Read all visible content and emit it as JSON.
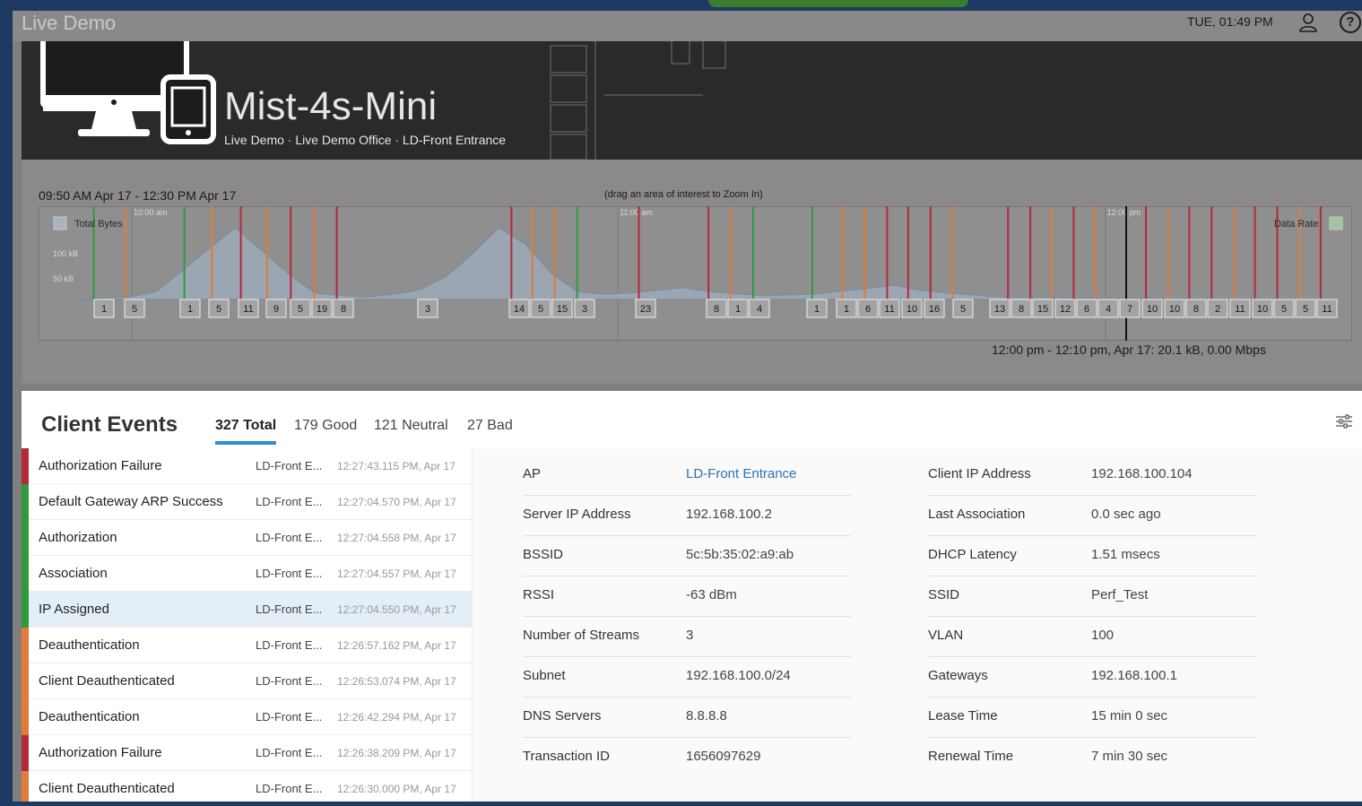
{
  "app": {
    "title": "Live Demo",
    "datetime": "TUE, 01:49 PM"
  },
  "device": {
    "name": "Mist-4s-Mini",
    "breadcrumb": "Live Demo · Live Demo Office · LD-Front Entrance"
  },
  "timeline": {
    "range_label": "09:50 AM Apr 17 - 12:30 PM Apr 17",
    "zoom_hint": "(drag an area of interest to Zoom In)",
    "legend_left": "Total Bytes",
    "legend_right": "Data Rate",
    "tooltip": "12:00 pm - 12:10 pm, Apr 17: 20.1 kB, 0.00 Mbps",
    "time_ticks": [
      {
        "label": "10:00 am",
        "x_pct": 7.1
      },
      {
        "label": "11:00 am",
        "x_pct": 44.1
      },
      {
        "label": "12:00 pm",
        "x_pct": 81.2
      }
    ],
    "y_ticks": [
      "100 kB",
      "50 kB"
    ],
    "event_counts": [
      "1",
      "5",
      "1",
      "5",
      "11",
      "9",
      "5",
      "19",
      "8",
      "3",
      "14",
      "5",
      "15",
      "3",
      "23",
      "8",
      "1",
      "4",
      "1",
      "1",
      "6",
      "11",
      "10",
      "16",
      "5",
      "13",
      "8",
      "15",
      "12",
      "6",
      "4",
      "7",
      "10",
      "10",
      "8",
      "2",
      "11",
      "10",
      "5",
      "5",
      "11"
    ],
    "event_lines": [
      {
        "t": 4.2,
        "c": "#2e9a3e"
      },
      {
        "t": 6.6,
        "c": "#e07b39"
      },
      {
        "t": 11.1,
        "c": "#2e9a3e"
      },
      {
        "t": 13.2,
        "c": "#e07b39"
      },
      {
        "t": 15.4,
        "c": "#b5283a"
      },
      {
        "t": 17.4,
        "c": "#e07b39"
      },
      {
        "t": 19.2,
        "c": "#b5283a"
      },
      {
        "t": 21.0,
        "c": "#e07b39"
      },
      {
        "t": 22.7,
        "c": "#b5283a"
      },
      {
        "t": 36.0,
        "c": "#b5283a"
      },
      {
        "t": 37.6,
        "c": "#e07b39"
      },
      {
        "t": 39.3,
        "c": "#e07b39"
      },
      {
        "t": 41.0,
        "c": "#2e9a3e"
      },
      {
        "t": 45.7,
        "c": "#b5283a"
      },
      {
        "t": 51.0,
        "c": "#b5283a"
      },
      {
        "t": 52.7,
        "c": "#e07b39"
      },
      {
        "t": 54.4,
        "c": "#2e9a3e"
      },
      {
        "t": 58.9,
        "c": "#2e9a3e"
      },
      {
        "t": 61.2,
        "c": "#e07b39"
      },
      {
        "t": 62.9,
        "c": "#e07b39"
      },
      {
        "t": 64.6,
        "c": "#b5283a"
      },
      {
        "t": 66.2,
        "c": "#b5283a"
      },
      {
        "t": 67.9,
        "c": "#b5283a"
      },
      {
        "t": 69.6,
        "c": "#e07b39"
      },
      {
        "t": 73.8,
        "c": "#b5283a"
      },
      {
        "t": 75.5,
        "c": "#b5283a"
      },
      {
        "t": 77.1,
        "c": "#e07b39"
      },
      {
        "t": 78.8,
        "c": "#b5283a"
      },
      {
        "t": 80.4,
        "c": "#e07b39"
      },
      {
        "t": 84.3,
        "c": "#b5283a"
      },
      {
        "t": 86.0,
        "c": "#e07b39"
      },
      {
        "t": 87.6,
        "c": "#b5283a"
      },
      {
        "t": 89.3,
        "c": "#b5283a"
      },
      {
        "t": 91.0,
        "c": "#e07b39"
      },
      {
        "t": 92.6,
        "c": "#b5283a"
      },
      {
        "t": 94.3,
        "c": "#b5283a"
      },
      {
        "t": 96.0,
        "c": "#e07b39"
      },
      {
        "t": 97.6,
        "c": "#b5283a"
      }
    ],
    "traffic_kb": [
      0,
      0,
      2,
      4,
      12,
      45,
      78,
      110,
      75,
      40,
      10,
      6,
      4,
      8,
      15,
      35,
      70,
      110,
      85,
      40,
      12,
      8,
      10,
      14,
      18,
      12,
      9,
      6,
      7,
      8,
      13,
      17,
      22,
      14,
      10,
      7,
      4,
      3,
      3,
      2,
      2,
      2,
      1,
      1,
      0,
      0,
      0
    ],
    "colors": {
      "good": "#2e9a3e",
      "neutral": "#e07b39",
      "bad": "#b5283a",
      "area": "#9aa6b2",
      "accent": "#2c8fd6"
    }
  },
  "events": {
    "title": "Client Events",
    "tabs": [
      "327 Total",
      "179 Good",
      "121 Neutral",
      "27 Bad"
    ],
    "rows": [
      {
        "name": "Authorization Failure",
        "ap": "LD-Front E...",
        "ts": "12:27:43.115 PM, Apr 17",
        "status": "bad"
      },
      {
        "name": "Default Gateway ARP Success",
        "ap": "LD-Front E...",
        "ts": "12:27:04.570 PM, Apr 17",
        "status": "good"
      },
      {
        "name": "Authorization",
        "ap": "LD-Front E...",
        "ts": "12:27:04.558 PM, Apr 17",
        "status": "good"
      },
      {
        "name": "Association",
        "ap": "LD-Front E...",
        "ts": "12:27:04.557 PM, Apr 17",
        "status": "good"
      },
      {
        "name": "IP Assigned",
        "ap": "LD-Front E...",
        "ts": "12:27:04.550 PM, Apr 17",
        "status": "good"
      },
      {
        "name": "Deauthentication",
        "ap": "LD-Front E...",
        "ts": "12:26:57.162 PM, Apr 17",
        "status": "neutral"
      },
      {
        "name": "Client Deauthenticated",
        "ap": "LD-Front E...",
        "ts": "12:26:53.074 PM, Apr 17",
        "status": "neutral"
      },
      {
        "name": "Deauthentication",
        "ap": "LD-Front E...",
        "ts": "12:26:42.294 PM, Apr 17",
        "status": "neutral"
      },
      {
        "name": "Authorization Failure",
        "ap": "LD-Front E...",
        "ts": "12:26:38.209 PM, Apr 17",
        "status": "bad"
      },
      {
        "name": "Client Deauthenticated",
        "ap": "LD-Front E...",
        "ts": "12:26:30.000 PM, Apr 17",
        "status": "neutral"
      }
    ],
    "selected_index": 4
  },
  "details": {
    "left": [
      {
        "label": "AP",
        "value": "LD-Front Entrance",
        "link": true
      },
      {
        "label": "Server IP Address",
        "value": "192.168.100.2"
      },
      {
        "label": "BSSID",
        "value": "5c:5b:35:02:a9:ab"
      },
      {
        "label": "RSSI",
        "value": "-63 dBm"
      },
      {
        "label": "Number of Streams",
        "value": "3"
      },
      {
        "label": "Subnet",
        "value": "192.168.100.0/24"
      },
      {
        "label": "DNS Servers",
        "value": "8.8.8.8"
      },
      {
        "label": "Transaction ID",
        "value": "1656097629"
      }
    ],
    "right": [
      {
        "label": "Client IP Address",
        "value": "192.168.100.104"
      },
      {
        "label": "Last Association",
        "value": "0.0 sec ago"
      },
      {
        "label": "DHCP Latency",
        "value": "1.51 msecs"
      },
      {
        "label": "SSID",
        "value": "Perf_Test"
      },
      {
        "label": "VLAN",
        "value": "100"
      },
      {
        "label": "Gateways",
        "value": "192.168.100.1"
      },
      {
        "label": "Lease Time",
        "value": "15 min 0 sec"
      },
      {
        "label": "Renewal Time",
        "value": "7 min 30 sec"
      }
    ]
  }
}
